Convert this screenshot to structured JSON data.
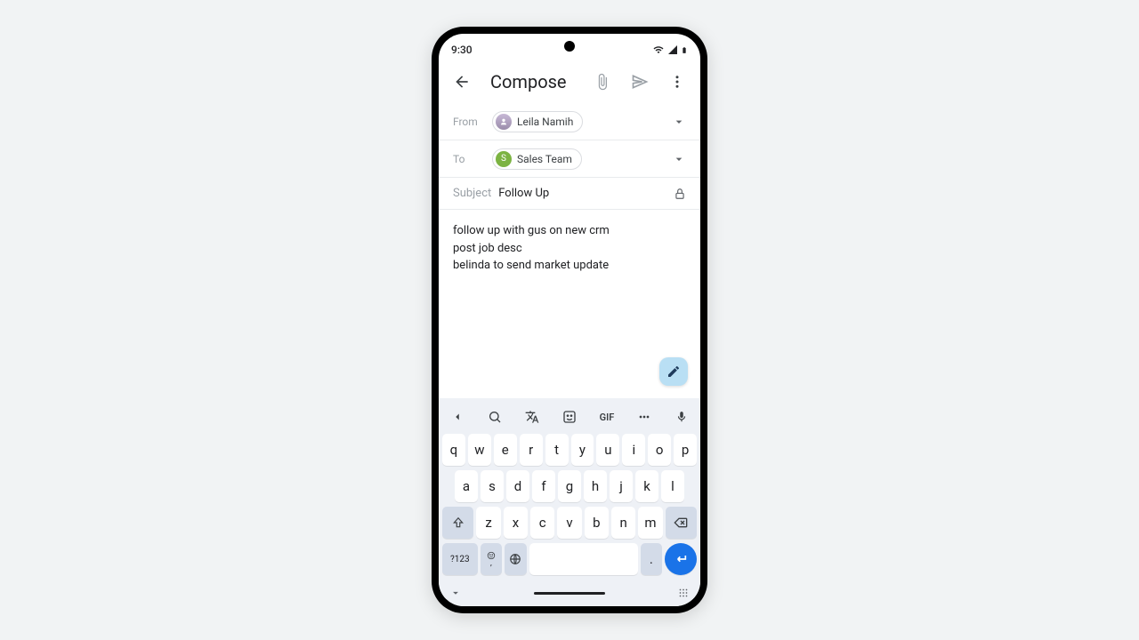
{
  "status": {
    "time": "9:30"
  },
  "appbar": {
    "title": "Compose"
  },
  "from": {
    "label": "From",
    "name": "Leila Namih"
  },
  "to": {
    "label": "To",
    "name": "Sales Team",
    "chip_letter": "S",
    "chip_color": "#7cb342"
  },
  "subject": {
    "label": "Subject",
    "value": "Follow Up"
  },
  "body": {
    "l1": "follow up with gus on new crm",
    "l2": "post job desc",
    "l3": "belinda to send market update"
  },
  "kb": {
    "gif": "GIF",
    "r1": {
      "0": "q",
      "1": "w",
      "2": "e",
      "3": "r",
      "4": "t",
      "5": "y",
      "6": "u",
      "7": "i",
      "8": "o",
      "9": "p"
    },
    "r2": {
      "0": "a",
      "1": "s",
      "2": "d",
      "3": "f",
      "4": "g",
      "5": "h",
      "6": "j",
      "7": "k",
      "8": "l"
    },
    "r3": {
      "0": "z",
      "1": "x",
      "2": "c",
      "3": "v",
      "4": "b",
      "5": "n",
      "6": "m"
    },
    "sym": "?123",
    "comma": ",",
    "period": "."
  }
}
